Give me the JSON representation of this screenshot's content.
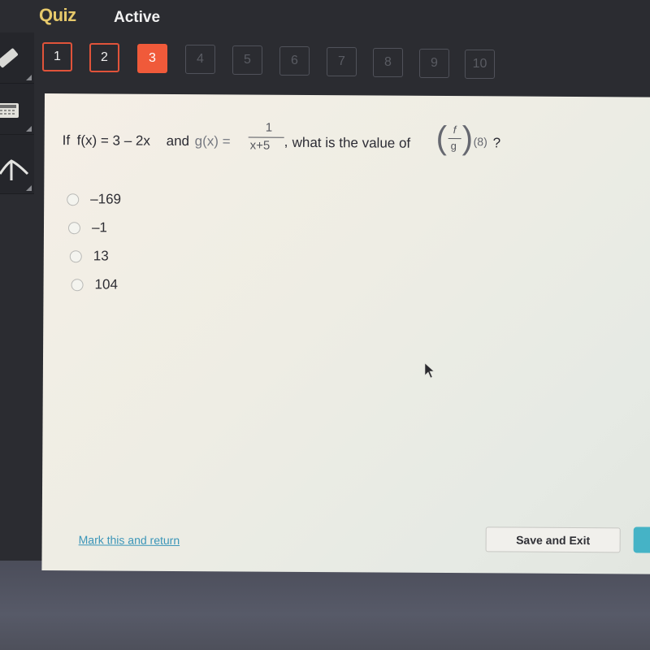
{
  "header": {
    "title": "Quiz",
    "status": "Active"
  },
  "question_nav": [
    {
      "label": "1",
      "state": "answered"
    },
    {
      "label": "2",
      "state": "answered"
    },
    {
      "label": "3",
      "state": "current"
    },
    {
      "label": "4",
      "state": "pending"
    },
    {
      "label": "5",
      "state": "pending"
    },
    {
      "label": "6",
      "state": "pending"
    },
    {
      "label": "7",
      "state": "pending"
    },
    {
      "label": "8",
      "state": "pending"
    },
    {
      "label": "9",
      "state": "pending"
    },
    {
      "label": "10",
      "state": "pending"
    }
  ],
  "toolbar": {
    "items": [
      {
        "name": "pencil-icon",
        "label": "Pencil"
      },
      {
        "name": "calculator-icon",
        "label": "Calculator"
      },
      {
        "name": "reference-icon",
        "label": "Reference"
      }
    ]
  },
  "question": {
    "part1": "If",
    "f_def": "f(x) = 3 – 2x",
    "and": "and",
    "g_name": "g(x) =",
    "g_num": "1",
    "g_den": "x+5",
    "comma": ",",
    "part2": "what is the value of",
    "quot_num": "f",
    "quot_den": "g",
    "arg": "(8)",
    "qmark": "?"
  },
  "choices": [
    {
      "label": "–169",
      "selected": false
    },
    {
      "label": "–1",
      "selected": false
    },
    {
      "label": "13",
      "selected": false
    },
    {
      "label": "104",
      "selected": false
    }
  ],
  "footer": {
    "mark_link": "Mark this and return",
    "save_button": "Save and Exit"
  },
  "colors": {
    "accent_current": "#f05a3a",
    "answered_border": "#e0533a",
    "link": "#3b95b8",
    "next_button": "#45b3c6",
    "title": "#e6c96b"
  }
}
